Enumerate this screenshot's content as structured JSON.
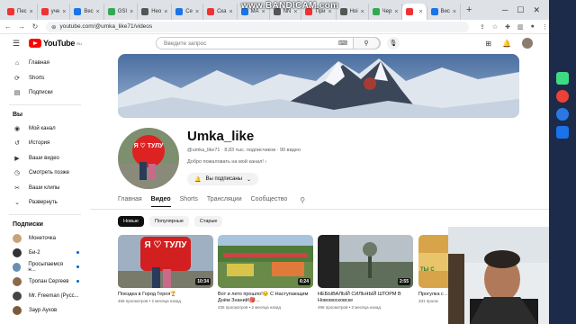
{
  "browser": {
    "tabs": [
      {
        "label": "Пес",
        "color": "#e33"
      },
      {
        "label": "уче",
        "color": "#e33"
      },
      {
        "label": "Вес",
        "color": "#1a73e8"
      },
      {
        "label": "GSI",
        "color": "#34a853"
      },
      {
        "label": "Нео",
        "color": "#555"
      },
      {
        "label": "Се",
        "color": "#1a73e8"
      },
      {
        "label": "Ска",
        "color": "#e33"
      },
      {
        "label": "MA",
        "color": "#1a73e8"
      },
      {
        "label": "NN",
        "color": "#555"
      },
      {
        "label": "При",
        "color": "#e33"
      },
      {
        "label": "Hoi",
        "color": "#555"
      },
      {
        "label": "Чер",
        "color": "#34a853"
      },
      {
        "label": "",
        "color": "#e33"
      },
      {
        "label": "Вис",
        "color": "#1a73e8"
      }
    ],
    "new_tab": "+",
    "url": "youtube.com/@umka_like71/videos",
    "recorder": "www.BANDICAM.com"
  },
  "header": {
    "logo": "YouTube",
    "logo_region": "RU",
    "search_placeholder": "Введите запрос"
  },
  "sidebar": {
    "main": [
      {
        "icon": "⌂",
        "label": "Главная"
      },
      {
        "icon": "⟳",
        "label": "Shorts"
      },
      {
        "icon": "▤",
        "label": "Подписки"
      }
    ],
    "you_title": "Вы",
    "you_items": [
      {
        "icon": "◉",
        "label": "Мой канал"
      },
      {
        "icon": "↺",
        "label": "История"
      },
      {
        "icon": "▶",
        "label": "Ваши видео"
      },
      {
        "icon": "◷",
        "label": "Смотреть позже"
      },
      {
        "icon": "✂",
        "label": "Ваши клипы"
      },
      {
        "icon": "⌄",
        "label": "Развернуть"
      }
    ],
    "subs_title": "Подписки",
    "subs": [
      {
        "label": "Монеточка",
        "color": "#c9a27a",
        "dot": false
      },
      {
        "label": "Би-2",
        "color": "#333",
        "dot": true
      },
      {
        "label": "Просыпаемся н...",
        "color": "#6b8fb2",
        "dot": true
      },
      {
        "label": "Тропан Сергеев",
        "color": "#8a6a4a",
        "dot": true
      },
      {
        "label": "Mr. Freeman (Русс...",
        "color": "#444",
        "dot": false
      },
      {
        "label": "Заур Аухов",
        "color": "#7a5a3a",
        "dot": false
      }
    ]
  },
  "channel": {
    "name": "Umka_like",
    "handle": "@umka_like71",
    "subscribers": "8,83 тыс. подписчиков",
    "videos": "90 видео",
    "description": "Добро пожаловать на мой канал!",
    "subscribed_label": "Вы подписаны",
    "avatar_text": "Я ♡ ТУЛУ"
  },
  "tabs": [
    "Главная",
    "Видео",
    "Shorts",
    "Трансляции",
    "Сообщество"
  ],
  "active_tab": "Видео",
  "chips": [
    "Новые",
    "Популярные",
    "Старые"
  ],
  "videos": [
    {
      "title": "Поездка в Город Героя🏆",
      "views": "465 просмотров",
      "age": "2 месяца назад",
      "duration": "10:34",
      "thumb_text": "Я ♡ ТУЛУ"
    },
    {
      "title": "Вот и лето прошло!😔 С Наступающим Днём Знаний!🎒...",
      "views": "436 просмотров",
      "age": "2 месяца назад",
      "duration": "6:24",
      "thumb_text": ""
    },
    {
      "title": "НЕБЫВАЛЫЙ СИЛЬНЫЙ ШТОРМ В Новомосковске",
      "views": "496 просмотров",
      "age": "2 месяца назад",
      "duration": "2:55",
      "thumb_text": ""
    },
    {
      "title": "Прогулка с ...",
      "views": "331 просм",
      "age": "",
      "duration": "",
      "thumb_text": "ТЫ С"
    }
  ]
}
